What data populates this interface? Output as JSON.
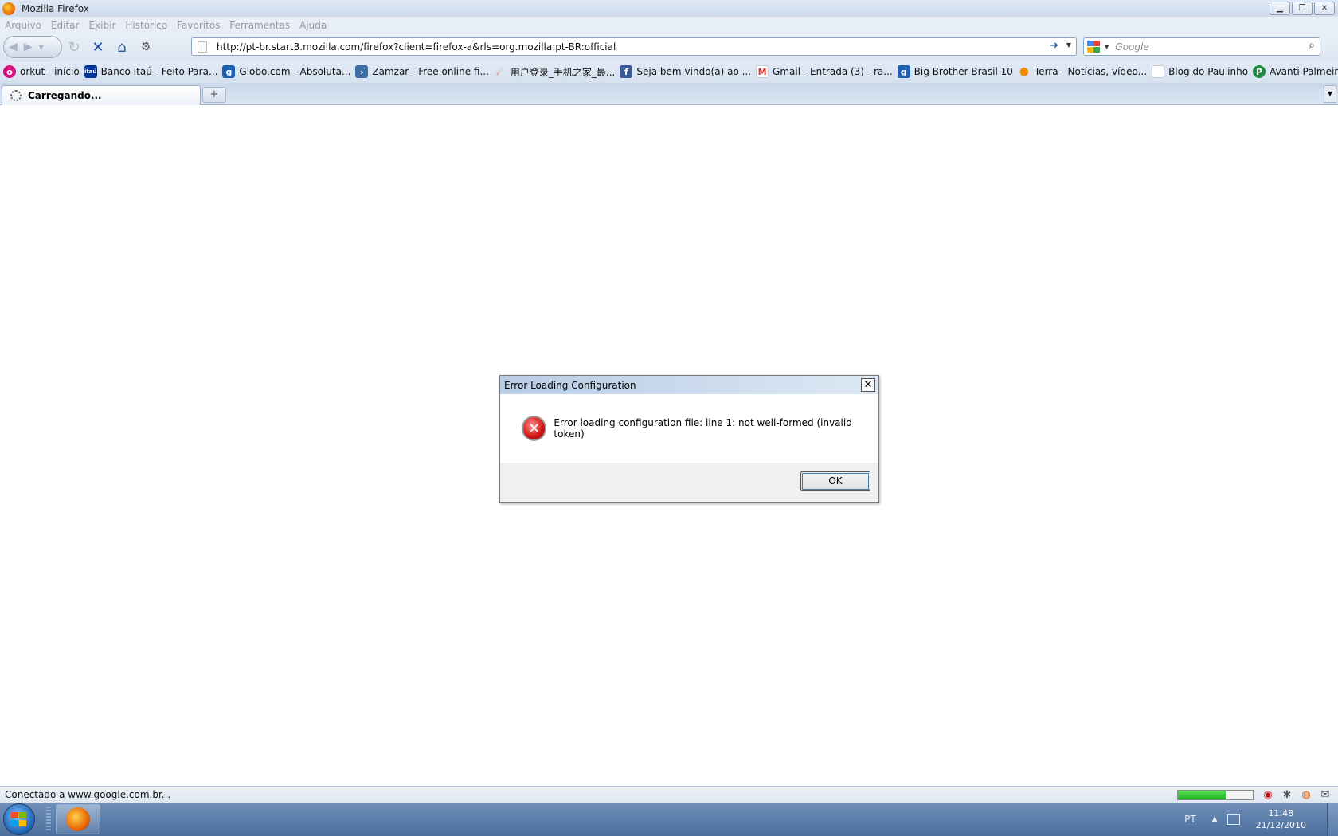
{
  "window": {
    "title": "Mozilla Firefox"
  },
  "menu": [
    "Arquivo",
    "Editar",
    "Exibir",
    "Histórico",
    "Favoritos",
    "Ferramentas",
    "Ajuda"
  ],
  "navigation": {
    "url": "http://pt-br.start3.mozilla.com/firefox?client=firefox-a&rls=org.mozilla:pt-BR:official",
    "search_placeholder": "Google"
  },
  "bookmarks": [
    {
      "label": "orkut - início",
      "icon": "orkut-icon",
      "color": "#d4117f"
    },
    {
      "label": "Banco Itaú - Feito Para...",
      "icon": "itau-icon",
      "color": "#003399"
    },
    {
      "label": "Globo.com - Absoluta...",
      "icon": "globo-icon",
      "color": "#1a5fb4"
    },
    {
      "label": "Zamzar - Free online fi...",
      "icon": "zamzar-icon",
      "color": "#3a6ea5"
    },
    {
      "label": "用户登录_手机之家_最...",
      "icon": "imobile-icon",
      "color": "#e03a2e"
    },
    {
      "label": "Seja bem-vindo(a) ao ...",
      "icon": "facebook-icon",
      "color": "#3b5998"
    },
    {
      "label": "Gmail - Entrada (3) - ra...",
      "icon": "gmail-icon",
      "color": "#d93025"
    },
    {
      "label": "Big Brother Brasil 10",
      "icon": "globo-icon",
      "color": "#1a5fb4"
    },
    {
      "label": "Terra - Notícias, vídeo...",
      "icon": "terra-icon",
      "color": "#f28c00"
    },
    {
      "label": "Blog do Paulinho",
      "icon": "blank-page-icon",
      "color": "#ffffff"
    },
    {
      "label": "Avanti Palmeiras",
      "icon": "palmeiras-icon",
      "color": "#1e8a3c"
    }
  ],
  "tab": {
    "label": "Carregando..."
  },
  "dialog": {
    "title": "Error Loading Configuration",
    "message": "Error loading configuration file: line 1: not well-formed (invalid token)",
    "ok_label": "OK"
  },
  "status": {
    "text": "Conectado a www.google.com.br...",
    "progress": 0.65
  },
  "taskbar": {
    "language": "PT",
    "time": "11:48",
    "date": "21/12/2010"
  }
}
